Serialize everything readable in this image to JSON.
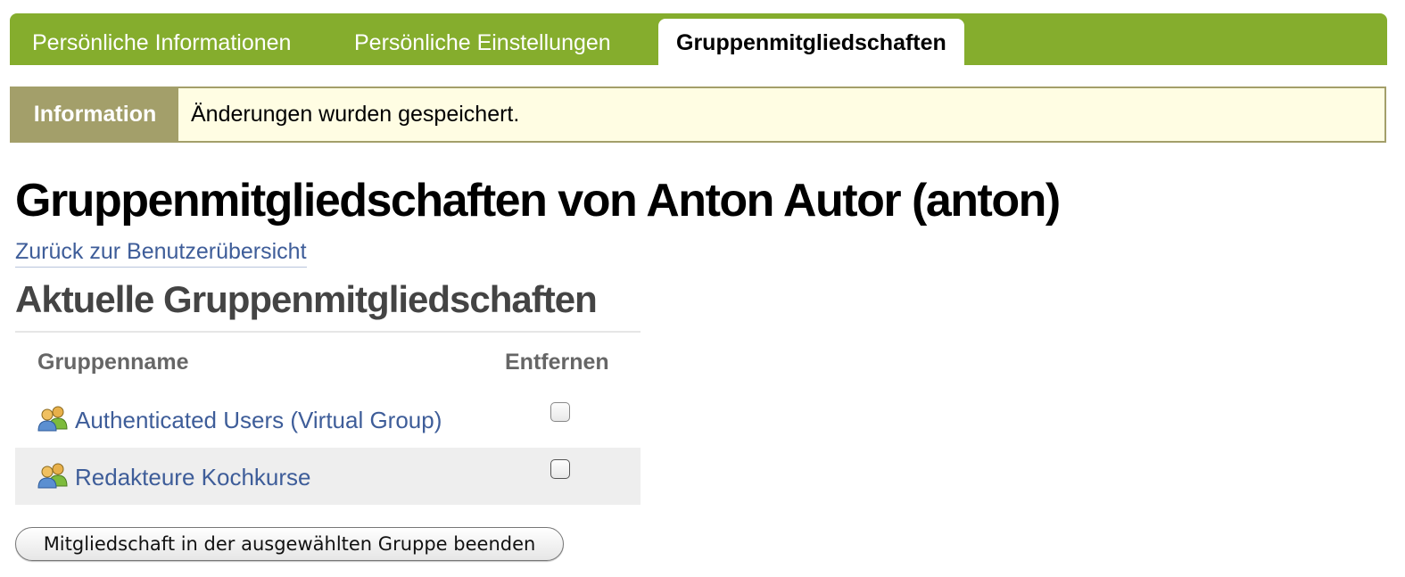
{
  "tabs": [
    {
      "label": "Persönliche Informationen",
      "active": false
    },
    {
      "label": "Persönliche Einstellungen",
      "active": false
    },
    {
      "label": "Gruppenmitgliedschaften",
      "active": true
    }
  ],
  "info": {
    "label": "Information",
    "message": "Änderungen wurden gespeichert."
  },
  "page_title": "Gruppenmitgliedschaften von Anton Autor (anton)",
  "back_link": "Zurück zur Benutzerübersicht",
  "section_title": "Aktuelle Gruppenmitgliedschaften",
  "table": {
    "headers": {
      "name": "Gruppenname",
      "remove": "Entfernen"
    },
    "rows": [
      {
        "name": "Authenticated Users (Virtual Group)",
        "icon": "group-icon",
        "checked": false
      },
      {
        "name": "Redakteure Kochkurse",
        "icon": "group-icon",
        "checked": false
      }
    ]
  },
  "submit_label": "Mitgliedschaft in der ausgewählten Gruppe beenden",
  "colors": {
    "tab_bar": "#85ad2d",
    "info_label_bg": "#a39f6a",
    "info_bg": "#fffde3",
    "link": "#3e5d99"
  }
}
